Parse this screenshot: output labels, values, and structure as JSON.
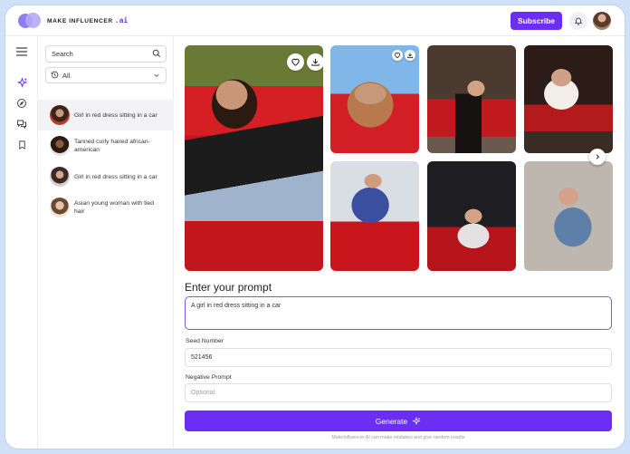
{
  "brand": {
    "name": "MAKE INFLUENCER",
    "suffix": ".ai",
    "accent": "#6c2ef2"
  },
  "header": {
    "subscribe_label": "Subscribe"
  },
  "rail": {
    "icons": [
      "menu-icon",
      "sparkle-icon",
      "compass-icon",
      "chat-icon",
      "bookmark-icon"
    ]
  },
  "sidebar": {
    "search_placeholder": "Search",
    "filter_label": "All",
    "items": [
      {
        "label": "Girl in red dress sitting in a car"
      },
      {
        "label": "Tanned curly haired african-american"
      },
      {
        "label": "Girl in red dress sitting in a car"
      },
      {
        "label": "Asian young woman with tied hair"
      }
    ]
  },
  "prompt": {
    "heading": "Enter your prompt",
    "value": "A girl in red dress sitting in a car"
  },
  "seed": {
    "label": "Seed Number",
    "value": "521456"
  },
  "negative": {
    "label": "Negative Prompt",
    "placeholder": "Optional"
  },
  "generate_label": "Generate",
  "disclaimer": "MakeInfluencer.AI can make mistakes and give random results"
}
